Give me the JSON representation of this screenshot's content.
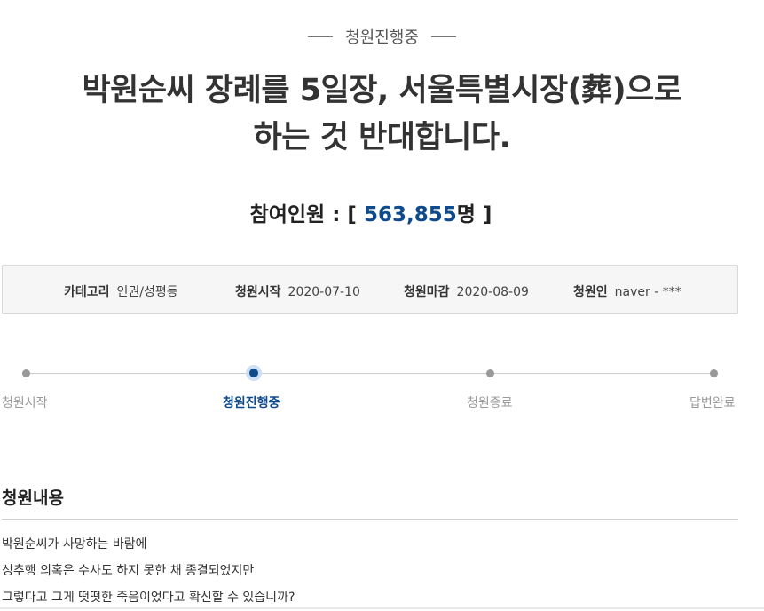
{
  "status_label": "청원진행중",
  "title_lines": [
    "박원순씨 장례를 5일장, 서울특별시장(葬)으로",
    "하는 것 반대합니다."
  ],
  "participants": {
    "label": "참여인원",
    "colon": " : ",
    "open_bracket": "[ ",
    "value": "563,855",
    "unit": "명",
    "close_bracket": " ]"
  },
  "meta": {
    "category": {
      "key": "카테고리",
      "value": "인권/성평등"
    },
    "start": {
      "key": "청원시작",
      "value": "2020-07-10"
    },
    "end": {
      "key": "청원마감",
      "value": "2020-08-09"
    },
    "author": {
      "key": "청원인",
      "value": "naver - ***"
    }
  },
  "progress_steps": [
    {
      "label": "청원시작",
      "active": false
    },
    {
      "label": "청원진행중",
      "active": true
    },
    {
      "label": "청원종료",
      "active": false
    },
    {
      "label": "답변완료",
      "active": false
    }
  ],
  "content_section": {
    "title": "청원내용",
    "lines": [
      "박원순씨가 사망하는 바람에",
      "성추행 의혹은 수사도 하지 못한 채 종결되었지만",
      "그렇다고 그게 떳떳한 죽음이었다고 확신할 수 있습니까?"
    ]
  },
  "colors": {
    "accent": "#0e4a8c",
    "muted": "#999999"
  }
}
